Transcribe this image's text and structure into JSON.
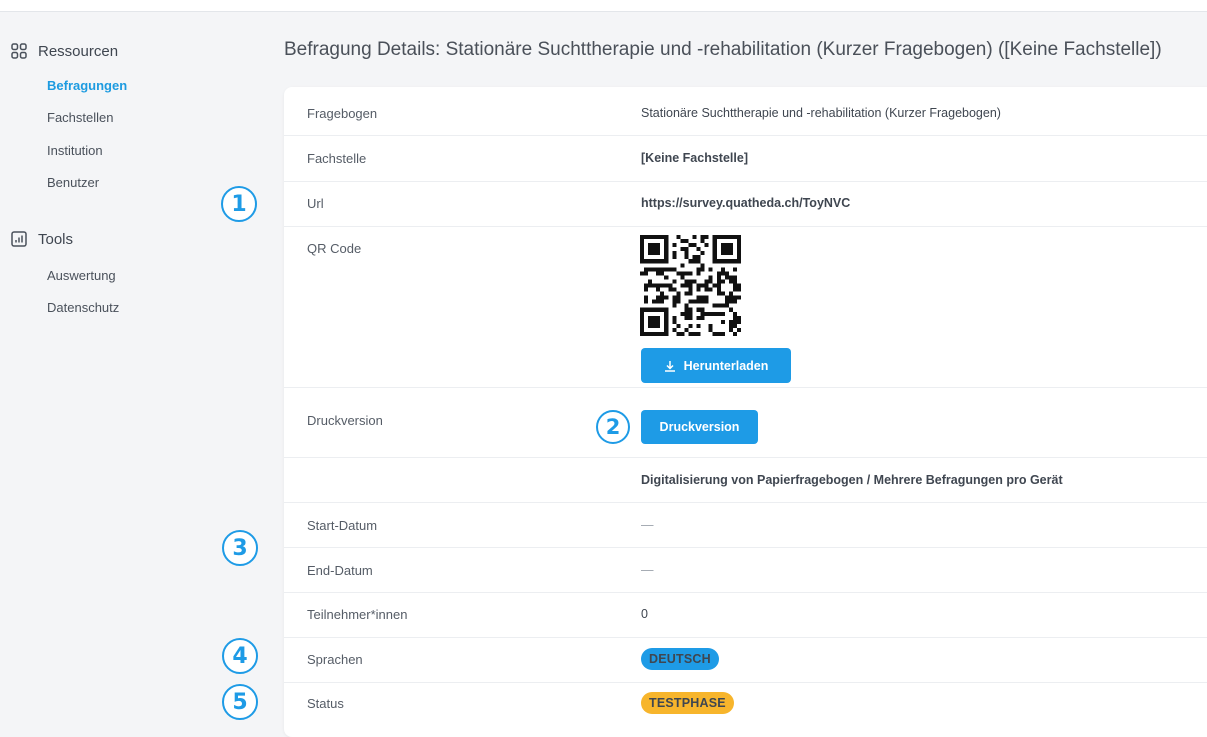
{
  "sidebar": {
    "groups": [
      {
        "label": "Ressourcen",
        "icon": "grid-icon",
        "items": [
          {
            "label": "Befragungen",
            "active": true
          },
          {
            "label": "Fachstellen"
          },
          {
            "label": "Institution"
          },
          {
            "label": "Benutzer"
          }
        ]
      },
      {
        "label": "Tools",
        "icon": "chart-icon",
        "items": [
          {
            "label": "Auswertung"
          },
          {
            "label": "Datenschutz"
          }
        ]
      }
    ]
  },
  "page": {
    "title": "Befragung Details: Stationäre Suchttherapie und -rehabilitation (Kurzer Fragebogen) ([Keine Fachstelle])"
  },
  "details": {
    "fragebogen": {
      "label": "Fragebogen",
      "value": "Stationäre Suchttherapie und -rehabilitation (Kurzer Fragebogen)"
    },
    "fachstelle": {
      "label": "Fachstelle",
      "value": "[Keine Fachstelle]"
    },
    "url": {
      "label": "Url",
      "value": "https://survey.quatheda.ch/ToyNVC"
    },
    "qr": {
      "label": "QR Code",
      "download_label": "Herunterladen",
      "download_icon": "download-icon"
    },
    "druck": {
      "label": "Druckversion",
      "button_label": "Druckversion"
    },
    "digital": {
      "link": "Digitalisierung von Papierfragebogen / Mehrere Befragungen pro Gerät"
    },
    "start": {
      "label": "Start-Datum",
      "value": "—"
    },
    "end": {
      "label": "End-Datum",
      "value": "—"
    },
    "teilnehmer": {
      "label": "Teilnehmer*innen",
      "value": "0"
    },
    "sprachen": {
      "label": "Sprachen",
      "value": "DEUTSCH"
    },
    "status": {
      "label": "Status",
      "value": "TESTPHASE"
    }
  },
  "callouts": [
    "1",
    "2",
    "3",
    "4",
    "5"
  ],
  "colors": {
    "accent": "#1e9be6",
    "link": "#1d8fd8",
    "status_badge": "#f7b52c",
    "language_badge": "#1e9be6"
  }
}
